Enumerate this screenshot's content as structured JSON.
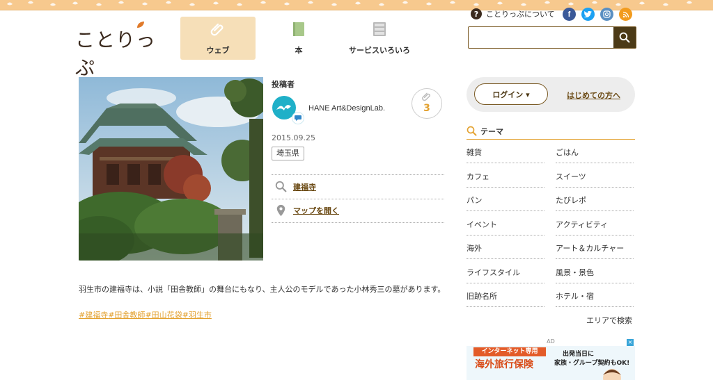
{
  "header": {
    "logo_text": "ことりっぷ",
    "nav": [
      {
        "label": "ウェブ",
        "active": true
      },
      {
        "label": "本",
        "active": false
      },
      {
        "label": "サービスいろいろ",
        "active": false
      }
    ],
    "about_label": "ことりっぷについて",
    "search_placeholder": ""
  },
  "post": {
    "poster_heading": "投稿者",
    "poster_name": "HANE Art&DesignLab.",
    "clip_count": "3",
    "date": "2015.09.25",
    "prefecture": "埼玉県",
    "spot_link": "建福寺",
    "map_link": "マップを開く",
    "description": "羽生市の建福寺は、小説「田舎教師」の舞台にもなり、主人公のモデルであった小林秀三の墓があります。",
    "tags": [
      "#建福寺",
      "#田舎教師",
      "#田山花袋",
      "#羽生市"
    ]
  },
  "sidebar": {
    "login_label": "ログイン ▾",
    "first_time_label": "はじめての方へ",
    "theme_heading": "テーマ",
    "themes": [
      "雑貨",
      "ごはん",
      "カフェ",
      "スイーツ",
      "パン",
      "たびレポ",
      "イベント",
      "アクティビティ",
      "海外",
      "アート＆カルチャー",
      "ライフスタイル",
      "風景・景色",
      "旧跡名所",
      "ホテル・宿"
    ],
    "area_search_label": "エリアで検索",
    "ad": {
      "label": "AD",
      "line1": "インターネット専用",
      "line2": "海外旅行保険",
      "right1": "出発当日に",
      "right2": "家族・グループ契約もOK!"
    }
  },
  "colors": {
    "accent": "#e3a12f",
    "brown": "#4c3a16",
    "nav_active": "#f6dfb8",
    "top_band": "#f7c98e"
  }
}
